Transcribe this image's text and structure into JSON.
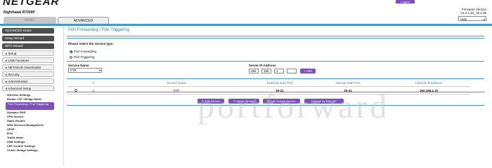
{
  "header": {
    "brand": "NETGEAR",
    "model": "Nighthawk R7000P",
    "logout_label": "Logout",
    "firmware_label": "Firmware Version",
    "firmware_version": "V1.3.1.64_10.1.36",
    "language": "Auto"
  },
  "tabs": {
    "basic": "BASIC",
    "advanced": "ADVANCED"
  },
  "sidebar": {
    "advanced_home": "ADVANCED Home",
    "setup_wizard": "Setup Wizard",
    "wps_wizard": "WPS Wizard",
    "sections": [
      "▸ Setup",
      "▸ USB Functions",
      "▸ NETGEAR Downloader",
      "▸ Security",
      "▸ Administration",
      "▾ Advanced Setup"
    ],
    "subitems": [
      "Wireless Settings",
      "Router / AP / Bridge Mode",
      "Port Forwarding / Port Triggering",
      "Dynamic DNS",
      "VPN Service",
      "Static Routes",
      "Web Services Management",
      "UPnP",
      "IPv6",
      "Traffic Meter",
      "USB Settings",
      "LED Control Settings",
      "VLAN / Bridge Settings"
    ]
  },
  "main": {
    "title": "Port Forwarding / Port Triggering",
    "select_service_type": "Please select the service type.",
    "option_forwarding": "Port Forwarding",
    "option_triggering": "Port Triggering",
    "service_name_label": "Service Name",
    "service_name_value": "FTP",
    "server_ip_label": "Server IP Address",
    "ip": [
      "192",
      "168",
      "1",
      ""
    ],
    "add_label": "+ Add",
    "table": {
      "headers": [
        "#",
        "Service Name",
        "External Start Port",
        "Internal Start Port",
        "Internal IP address"
      ],
      "rows": [
        {
          "num": "1",
          "service": "FTP",
          "ext": "20-21",
          "int": "20-21",
          "ip": "192.168.1.10"
        }
      ]
    },
    "buttons": {
      "edit": "✎ Edit Service",
      "delete": "✕ Delete Service",
      "add_custom": "+ Add Custom Service",
      "change": "Change by MAC/AP"
    },
    "watermark": "portforward"
  },
  "colors": {
    "accent_purple": "#7d4fbf",
    "rule_blue": "#3a9bd5",
    "title_blue": "#3a7bbf"
  }
}
